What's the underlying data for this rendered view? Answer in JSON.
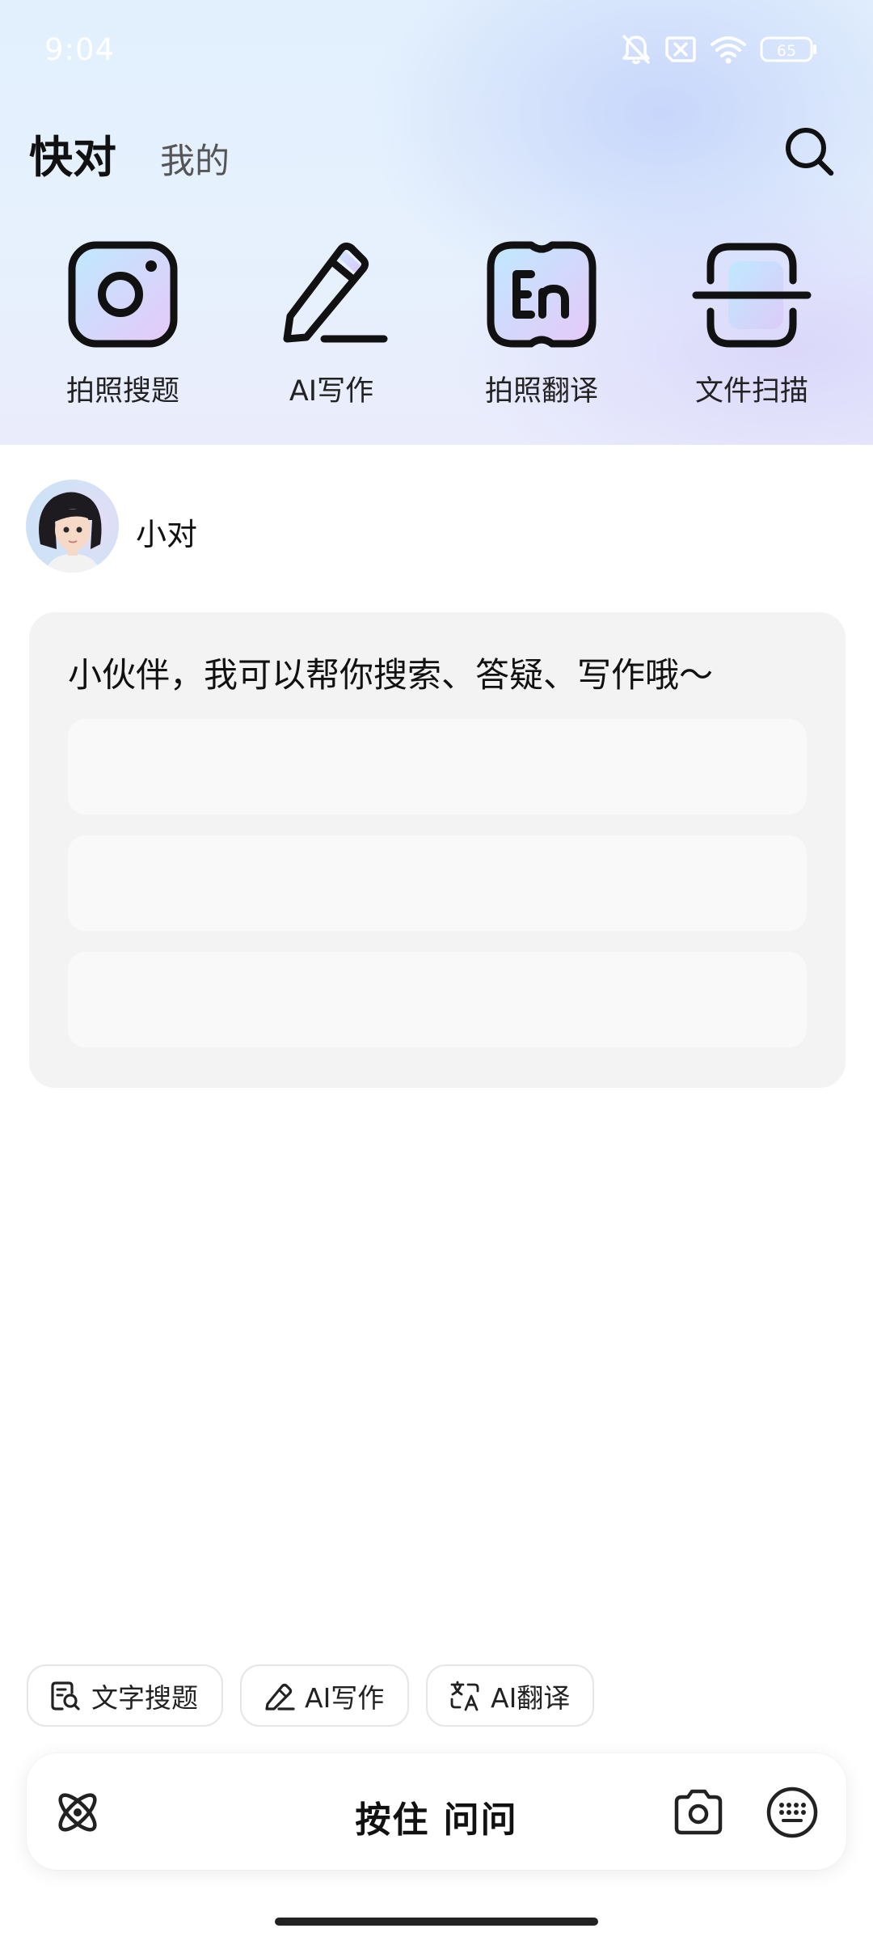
{
  "status_bar": {
    "time": "9:04",
    "battery": "65"
  },
  "header": {
    "tab_active": "快对",
    "tab_inactive": "我的"
  },
  "features": [
    {
      "label": "拍照搜题",
      "icon": "camera-icon"
    },
    {
      "label": "AI写作",
      "icon": "pencil-icon"
    },
    {
      "label": "拍照翻译",
      "icon": "translate-en-icon"
    },
    {
      "label": "文件扫描",
      "icon": "scan-icon"
    }
  ],
  "bot": {
    "name": "小对"
  },
  "message": {
    "text": "小伙伴，我可以帮你搜索、答疑、写作哦～"
  },
  "chips": [
    {
      "label": "文字搜题",
      "icon": "text-search-icon"
    },
    {
      "label": "AI写作",
      "icon": "pen-icon"
    },
    {
      "label": "AI翻译",
      "icon": "translate-icon"
    }
  ],
  "input_bar": {
    "hold_label": "按住 问问"
  },
  "colors": {
    "accent_gradient_start": "#e2f0fd",
    "accent_gradient_end": "#eaecfc",
    "card_bg": "#f3f3f3"
  }
}
